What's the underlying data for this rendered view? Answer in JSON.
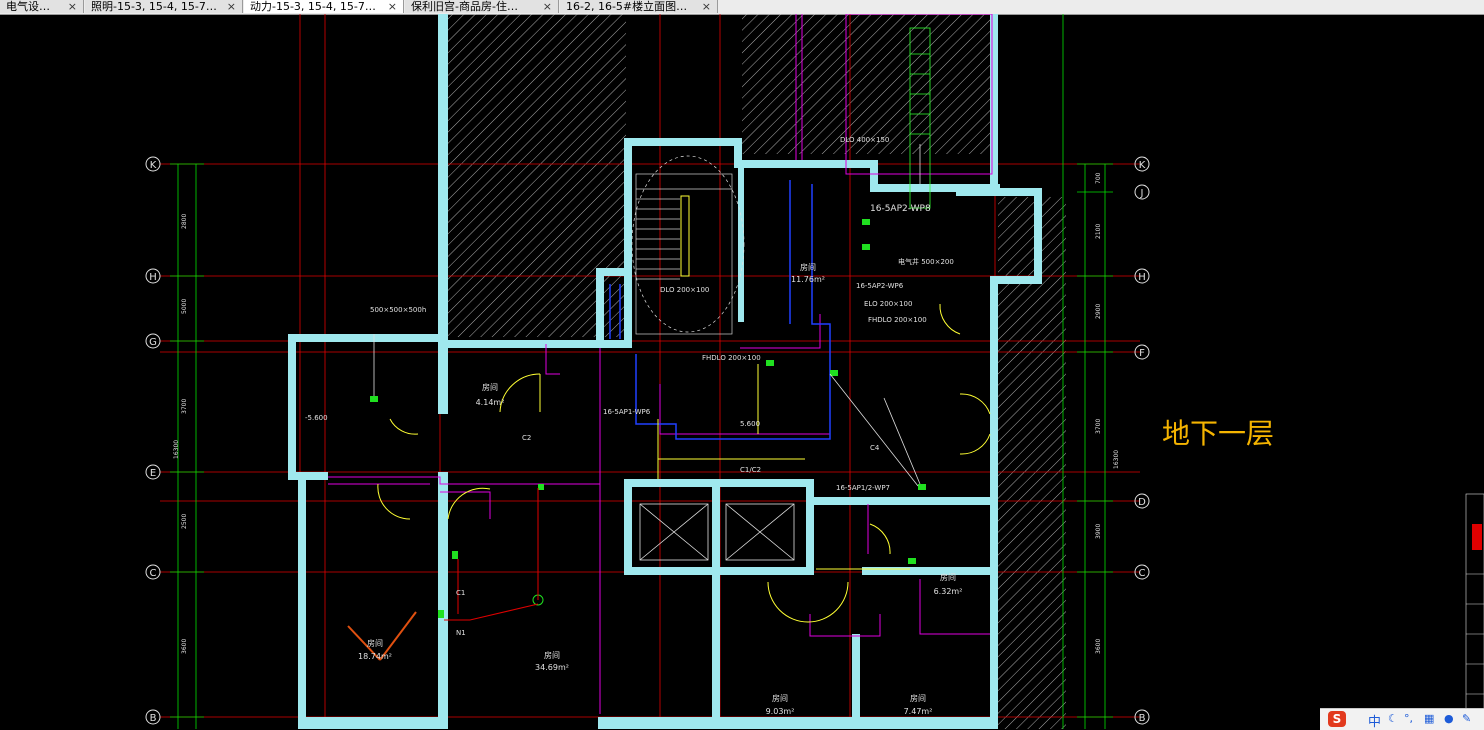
{
  "tabs": [
    {
      "label": "电气设…",
      "active": false
    },
    {
      "label": "照明-15-3, 15-4, 15-7…",
      "active": false
    },
    {
      "label": "动力-15-3, 15-4, 15-7…",
      "active": true
    },
    {
      "label": "保利旧宫-商品房-住…",
      "active": false
    },
    {
      "label": "16-2, 16-5#楼立面图…",
      "active": false
    }
  ],
  "tab_close_glyph": "×",
  "floor_label": "地下一层",
  "axis_labels_left": [
    "K",
    "H",
    "G",
    "E",
    "C",
    "B"
  ],
  "axis_labels_right": [
    "K",
    "J",
    "H",
    "F",
    "D",
    "C",
    "B"
  ],
  "dims_left": [
    "2800",
    "5000",
    "3700",
    "16300",
    "2500",
    "3600"
  ],
  "dims_right": [
    "700",
    "2100",
    "2900",
    "3700",
    "16300",
    "3900",
    "3600"
  ],
  "annotations": {
    "dlo_top": "DLO 400×150",
    "ap2_wp8": "16-5AP2-WP8",
    "ap2_wp6": "16-5AP2-WP6",
    "ap2_wp7": "16-5AP1/2-WP7",
    "ap_wp6b": "16-5AP1-WP6",
    "dlo_200": "DLO 200×100",
    "fhdlo_200_a": "FHDLO 200×100",
    "fhdlo_200_b": "FHDLO 200×100",
    "elo_200": "ELO 200×100",
    "duct_size": "500×500×500h",
    "elec_room": "电气井 500×200",
    "elev_z": "5.600",
    "elev_z2": "-5.600",
    "c1_c2": "C1/C2",
    "c2": "C2",
    "c1": "C1",
    "c4": "C4",
    "n1": "N1"
  },
  "rooms": [
    {
      "name": "房间",
      "area": "4.14m²"
    },
    {
      "name": "房间",
      "area": "18.74m²"
    },
    {
      "name": "房间",
      "area": "34.69m²"
    },
    {
      "name": "房间",
      "area": "9.03m²"
    },
    {
      "name": "房间",
      "area": "7.47m²"
    },
    {
      "name": "房间",
      "area": "6.32m²"
    },
    {
      "name": "房间",
      "area": "11.76m²"
    }
  ],
  "ime": {
    "logo": "S",
    "mode": "中"
  },
  "colors": {
    "wall": "#9fe8ee",
    "grid_red": "#e00000",
    "dim_green": "#00e000",
    "magenta": "#e000e0",
    "blue": "#2040ff",
    "yellow": "#ffff33",
    "label_orange": "#f5b400"
  }
}
